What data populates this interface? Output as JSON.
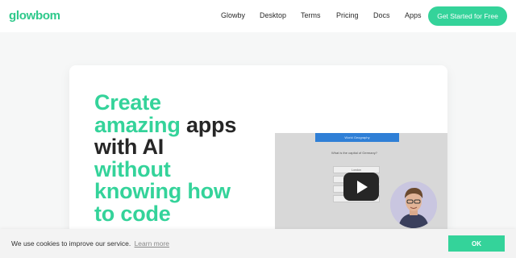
{
  "brand": {
    "logo_text": "glowbom",
    "accent_color": "#34d39a"
  },
  "nav": {
    "links": [
      "Glowby",
      "Desktop",
      "Terms",
      "Pricing",
      "Docs",
      "Apps"
    ],
    "cta_label": "Get Started for Free"
  },
  "hero": {
    "headline_parts": [
      "Create",
      "amazing",
      "apps",
      "with AI",
      "without",
      "knowing how",
      "to code"
    ]
  },
  "video": {
    "header_text": "World Geography",
    "question": "What is the capital of Germany?",
    "options": [
      "London",
      "Berlin",
      "Paris",
      "Rome"
    ],
    "play_icon": "play-icon"
  },
  "cookie": {
    "message": "We use cookies to improve our service.",
    "link_text": "Learn more",
    "button_label": "OK"
  }
}
